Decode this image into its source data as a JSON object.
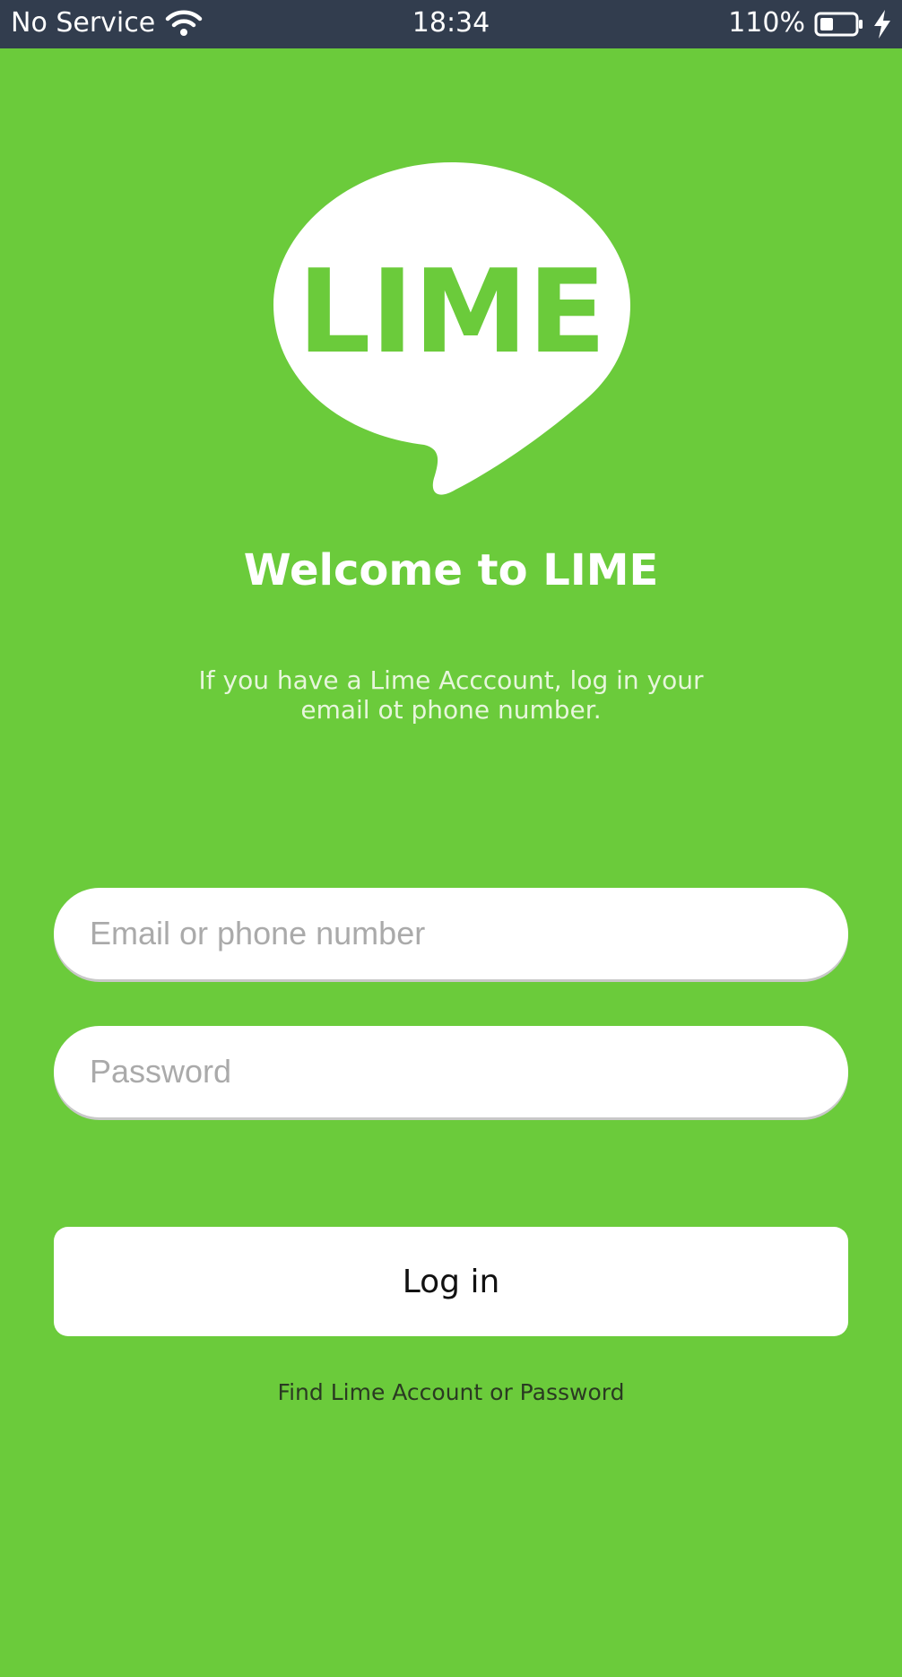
{
  "status_bar": {
    "carrier": "No Service",
    "time": "18:34",
    "battery_percent": "110%",
    "icons": [
      "wifi-icon",
      "battery-icon",
      "charging-bolt-icon"
    ]
  },
  "logo": {
    "text": "LIME",
    "icon": "speech-bubble-logo"
  },
  "welcome_title": "Welcome to LIME",
  "subtitle": "If you have a Lime Acccount, log in your email ot phone number.",
  "form": {
    "email_placeholder": "Email or phone number",
    "password_placeholder": "Password",
    "email_value": "",
    "password_value": ""
  },
  "login_button_label": "Log in",
  "find_account_link": "Find Lime Account or Password",
  "colors": {
    "background": "#6bcb3b",
    "status_bar": "#323d4e",
    "white": "#ffffff"
  }
}
